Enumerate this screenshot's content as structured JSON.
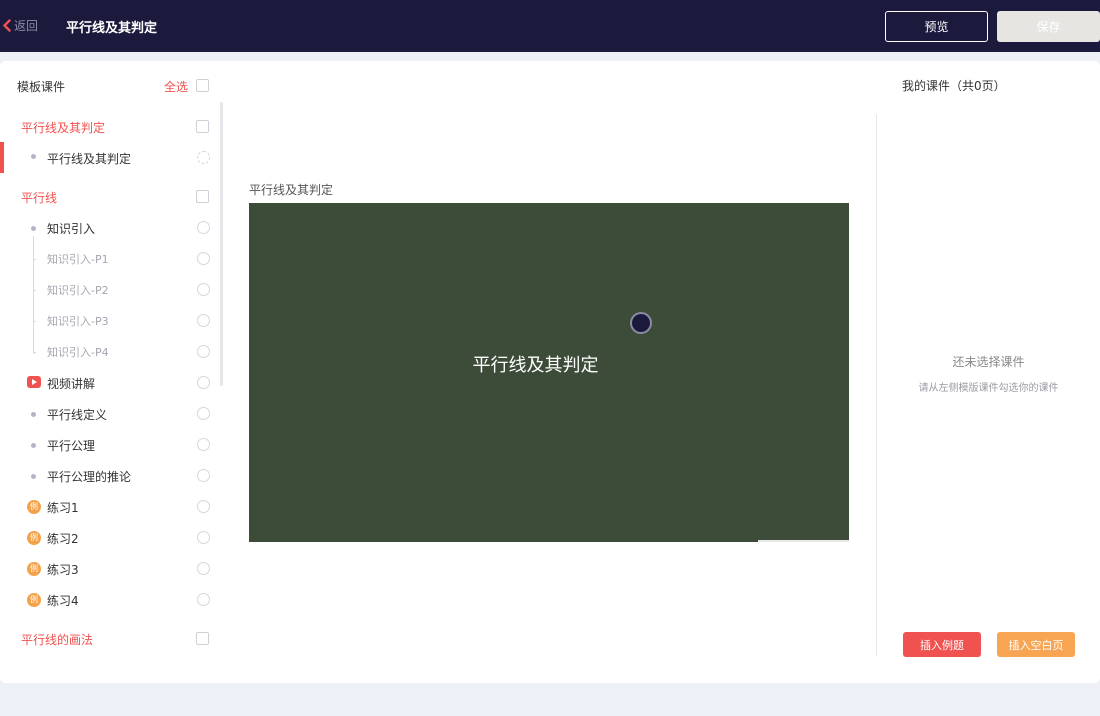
{
  "header": {
    "back_label": "返回",
    "title": "平行线及其判定",
    "preview_label": "预览",
    "save_label": "保存"
  },
  "left": {
    "title": "模板课件",
    "select_all_label": "全选",
    "groups": [
      {
        "label": "平行线及其判定",
        "items": [
          {
            "label": "平行线及其判定"
          }
        ]
      },
      {
        "label": "平行线",
        "items": [
          {
            "label": "知识引入"
          },
          {
            "label": "知识引入-P1"
          },
          {
            "label": "知识引入-P2"
          },
          {
            "label": "知识引入-P3"
          },
          {
            "label": "知识引入-P4"
          },
          {
            "label": "视频讲解",
            "icon": "video-play-icon"
          },
          {
            "label": "平行线定义"
          },
          {
            "label": "平行公理"
          },
          {
            "label": "平行公理的推论"
          },
          {
            "label": "练习1",
            "icon": "example-badge-icon",
            "icon_text": "例"
          },
          {
            "label": "练习2",
            "icon": "example-badge-icon",
            "icon_text": "例"
          },
          {
            "label": "练习3",
            "icon": "example-badge-icon",
            "icon_text": "例"
          },
          {
            "label": "练习4",
            "icon": "example-badge-icon",
            "icon_text": "例"
          }
        ]
      },
      {
        "label": "平行线的画法",
        "items": []
      }
    ]
  },
  "center": {
    "preview_title": "平行线及其判定",
    "slide_title": "平行线及其判定"
  },
  "right": {
    "title": "我的课件（共0页）",
    "empty_title": "还未选择课件",
    "empty_subtitle": "请从左侧模版课件勾选你的课件",
    "insert_example_label": "插入例题",
    "insert_blank_label": "插入空白页"
  },
  "colors": {
    "header_bg": "#1b1a3d",
    "accent_red": "#f0524f",
    "accent_orange": "#f7a552",
    "slide_bg": "#3d4b39",
    "page_bg": "#eef0f7"
  }
}
